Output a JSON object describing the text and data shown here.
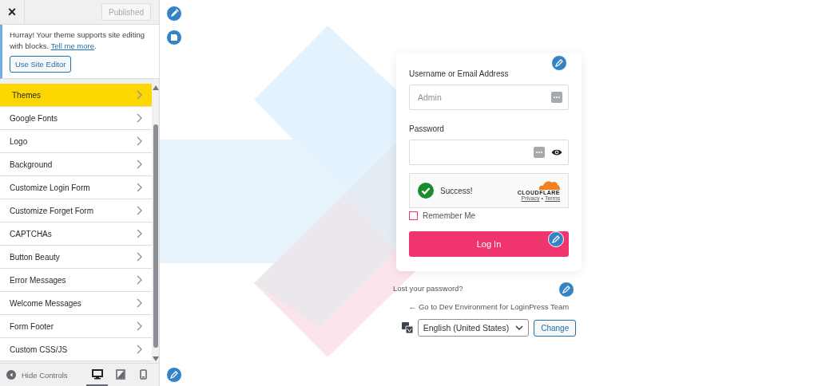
{
  "header": {
    "close": "×",
    "publish_button": "Published"
  },
  "notice": {
    "text": "Hurray! Your theme supports site editing with blocks. ",
    "link": "Tell me more",
    "after": ".",
    "button": "Use Site Editor"
  },
  "menu": [
    {
      "label": "Themes",
      "selected": true
    },
    {
      "label": "Google Fonts",
      "selected": false
    },
    {
      "label": "Logo",
      "selected": false
    },
    {
      "label": "Background",
      "selected": false
    },
    {
      "label": "Customize Login Form",
      "selected": false
    },
    {
      "label": "Customize Forget Form",
      "selected": false
    },
    {
      "label": "CAPTCHAs",
      "selected": false
    },
    {
      "label": "Button Beauty",
      "selected": false
    },
    {
      "label": "Error Messages",
      "selected": false
    },
    {
      "label": "Welcome Messages",
      "selected": false
    },
    {
      "label": "Form Footer",
      "selected": false
    },
    {
      "label": "Custom CSS/JS",
      "selected": false
    }
  ],
  "footer": {
    "hide_controls": "Hide Controls",
    "devices": [
      {
        "kind": "desktop",
        "selected": true
      },
      {
        "kind": "tablet",
        "selected": false
      },
      {
        "kind": "mobile",
        "selected": false
      }
    ]
  },
  "login": {
    "username_label": "Username or Email Address",
    "username_placeholder": "Admin",
    "password_label": "Password",
    "captcha": {
      "status": "Success!",
      "brand": "CLOUDFLARE",
      "privacy": "Privacy",
      "separator": "•",
      "terms": "Terms"
    },
    "remember": {
      "label": "Remember Me",
      "checked": false
    },
    "button": "Log In"
  },
  "lost_password": "Lost your password?",
  "back_link": "← Go to Dev Environment for LoginPress Team",
  "language": {
    "value": "English (United States)",
    "button": "Change"
  }
}
